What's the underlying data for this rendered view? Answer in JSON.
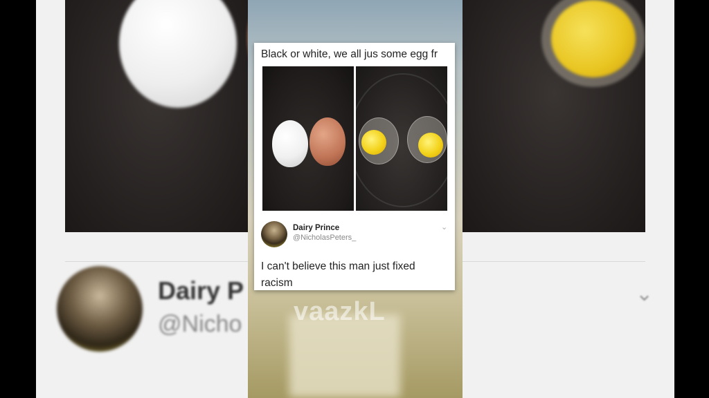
{
  "meme": {
    "caption": "Black or white, we all jus some egg fr",
    "tweet": {
      "name": "Dairy Prince",
      "handle": "@NicholasPeters_",
      "text": "I can't believe this man just fixed racism",
      "chevron_icon": "chevron-down-icon"
    }
  },
  "background": {
    "blurred_name": "Dairy P",
    "blurred_handle": "@Nicho",
    "chevron_icon": "chevron-down-icon"
  },
  "watermark": "vaazkL",
  "colors": {
    "card_bg": "#ffffff",
    "text": "#222222",
    "handle": "#888888",
    "yolk": "#f3d21a",
    "brown_egg": "#c07456"
  }
}
